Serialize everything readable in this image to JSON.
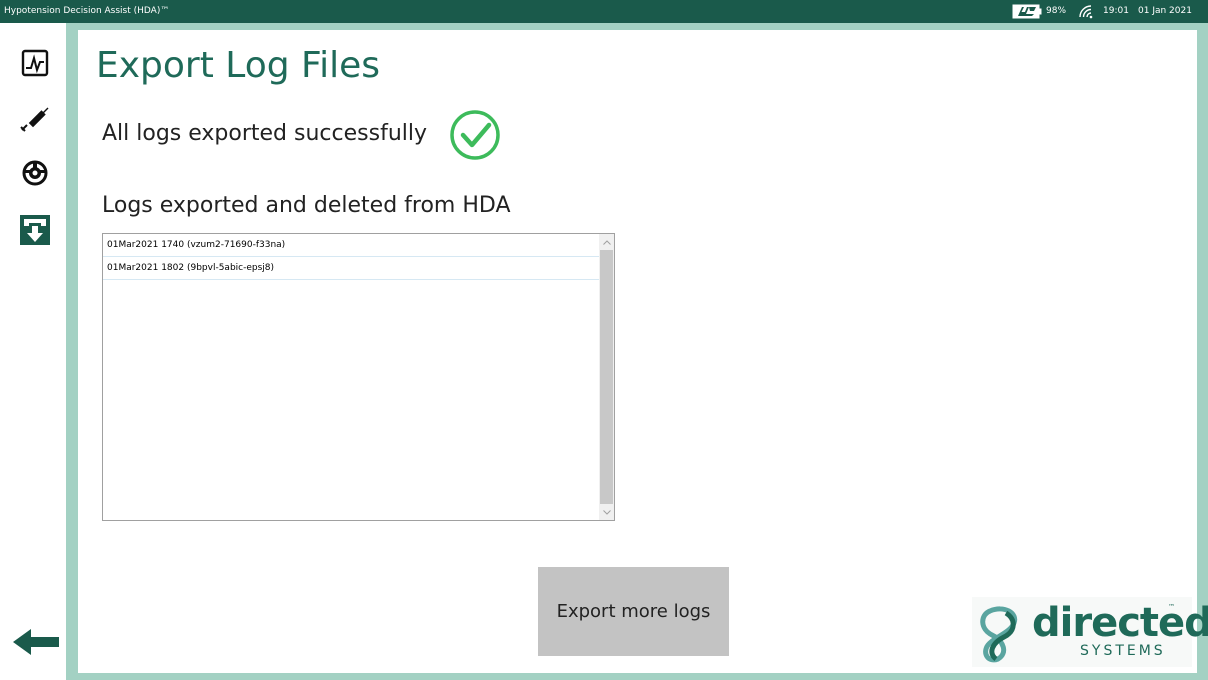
{
  "titlebar": {
    "app_title": "Hypotension Decision Assist (HDA)™",
    "battery_level": "98%",
    "time": "19:01",
    "date": "01 Jan 2021",
    "battery_icon": "battery-charging-icon",
    "signal_icon": "wireless-signal-icon"
  },
  "sidebar": {
    "items": [
      {
        "icon": "monitor-chart-icon"
      },
      {
        "icon": "syringe-icon"
      },
      {
        "icon": "settings-gear-icon"
      },
      {
        "icon": "export-download-icon",
        "active": true
      }
    ],
    "back_icon": "arrow-left-icon"
  },
  "main": {
    "title": "Export Log Files",
    "status_message": "All logs exported successfully",
    "status_icon": "check-circle-icon",
    "list_heading": "Logs exported and deleted from HDA",
    "logs": [
      "01Mar2021 1740 (vzum2-71690-f33na)",
      "01Mar2021 1802 (9bpvl-5abic-epsj8)"
    ],
    "export_more_label": "Export more logs"
  },
  "logo": {
    "wordmark": "directed",
    "subtitle": "SYSTEMS",
    "tm": "™"
  },
  "colors": {
    "primary": "#1a5a4b",
    "accent": "#1f6a59",
    "frame": "#a3d1c3",
    "success": "#3dbb5b",
    "button": "#c3c3c3"
  }
}
